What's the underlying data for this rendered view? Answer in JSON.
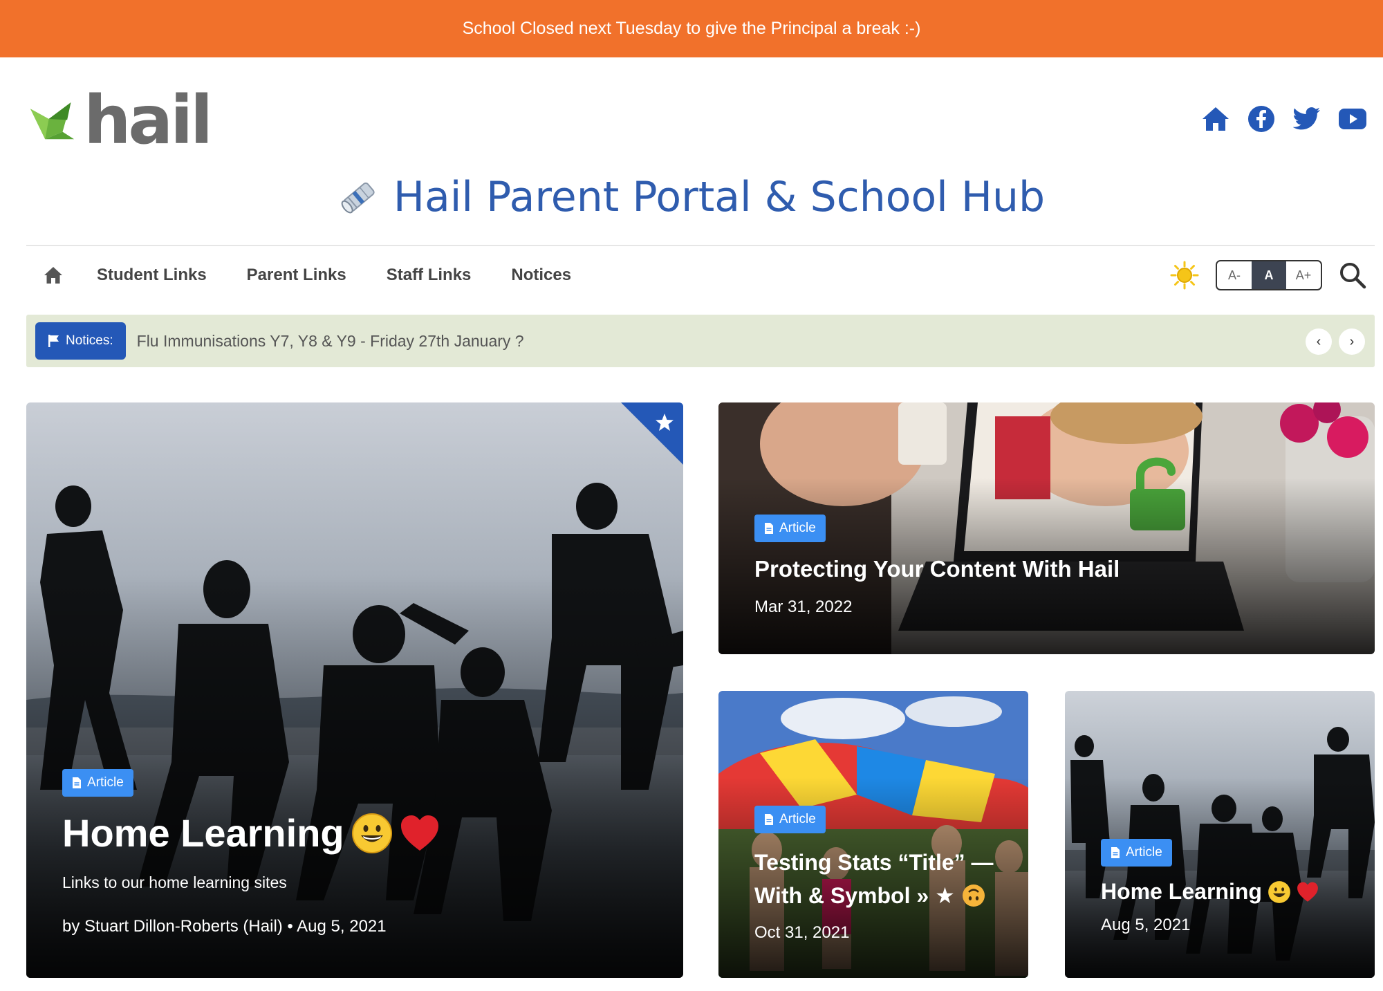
{
  "announcement": {
    "text": "School Closed next Tuesday to give the Principal a break :-)"
  },
  "logo": {
    "text": "hail"
  },
  "social": [
    {
      "name": "home-icon"
    },
    {
      "name": "facebook-icon"
    },
    {
      "name": "twitter-icon"
    },
    {
      "name": "youtube-icon"
    }
  ],
  "site": {
    "title": "Hail Parent Portal & School Hub"
  },
  "nav": {
    "items": [
      "Student Links",
      "Parent Links",
      "Staff Links",
      "Notices"
    ],
    "font_sizes": [
      "A-",
      "A",
      "A+"
    ]
  },
  "ticker": {
    "label": "Notices:",
    "text": "Flu Immunisations Y7, Y8 & Y9 - Friday 27th January ?"
  },
  "cards": {
    "featured": {
      "tag": "Article",
      "title": "Home Learning",
      "excerpt": "Links to our home learning sites",
      "byline": "by Stuart Dillon-Roberts (Hail) • Aug 5, 2021"
    },
    "top_right": {
      "tag": "Article",
      "title": "Protecting Your Content With Hail",
      "date": "Mar 31, 2022"
    },
    "bottom_mid": {
      "tag": "Article",
      "title_line1": "Testing Stats “Title” —",
      "title_line2": "With & Symbol » ★",
      "date": "Oct 31, 2021"
    },
    "bottom_right": {
      "tag": "Article",
      "title": "Home Learning",
      "date": "Aug 5, 2021"
    }
  },
  "colors": {
    "announcement_bg": "#f1712b",
    "brand_blue": "#2f5cae",
    "badge_blue": "#2458b7",
    "tag_blue": "#3b8ff3",
    "ticker_bg": "#e3e9d6"
  }
}
